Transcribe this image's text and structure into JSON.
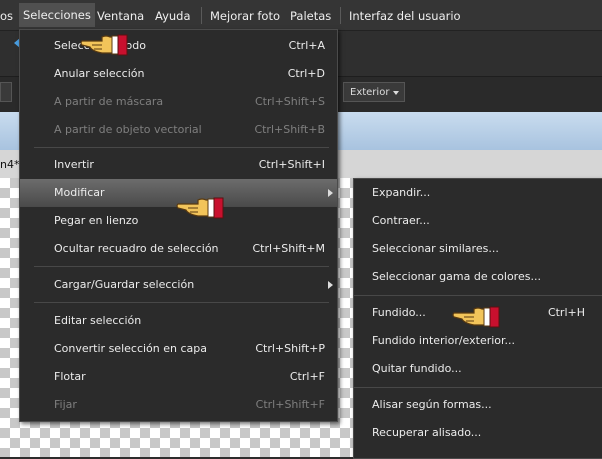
{
  "menubar": {
    "items": [
      "os",
      "Selecciones",
      "Ventana",
      "Ayuda",
      "Mejorar foto",
      "Paletas",
      "Interfaz del usuario"
    ]
  },
  "background": {
    "tab_label": "n4*",
    "dropdown_label": "Exterior"
  },
  "main_menu": [
    {
      "label": "Seleccionar todo",
      "shortcut": "Ctrl+A"
    },
    {
      "label": "Anular selección",
      "shortcut": "Ctrl+D"
    },
    {
      "label": "A partir de máscara",
      "shortcut": "Ctrl+Shift+S"
    },
    {
      "label": "A partir de objeto vectorial",
      "shortcut": "Ctrl+Shift+B"
    },
    {
      "label": "Invertir",
      "shortcut": "Ctrl+Shift+I"
    },
    {
      "label": "Modificar",
      "shortcut": ""
    },
    {
      "label": "Pegar en lienzo",
      "shortcut": ""
    },
    {
      "label": "Ocultar recuadro de selección",
      "shortcut": "Ctrl+Shift+M"
    },
    {
      "label": "Cargar/Guardar selección",
      "shortcut": ""
    },
    {
      "label": "Editar selección",
      "shortcut": ""
    },
    {
      "label": "Convertir selección en capa",
      "shortcut": "Ctrl+Shift+P"
    },
    {
      "label": "Flotar",
      "shortcut": "Ctrl+F"
    },
    {
      "label": "Fijar",
      "shortcut": "Ctrl+Shift+F"
    }
  ],
  "sub_menu": [
    {
      "label": "Expandir...",
      "shortcut": ""
    },
    {
      "label": "Contraer...",
      "shortcut": ""
    },
    {
      "label": "Seleccionar similares...",
      "shortcut": ""
    },
    {
      "label": "Seleccionar gama de colores...",
      "shortcut": ""
    },
    {
      "label": "Fundido...",
      "shortcut": "Ctrl+H"
    },
    {
      "label": "Fundido interior/exterior...",
      "shortcut": ""
    },
    {
      "label": "Quitar fundido...",
      "shortcut": ""
    },
    {
      "label": "Alisar según formas...",
      "shortcut": ""
    },
    {
      "label": "Recuperar alisado...",
      "shortcut": ""
    }
  ],
  "colors": {
    "menu_bg": "#2b2b2b",
    "highlight": "#5a5a5a",
    "disabled_text": "#7f7f7f",
    "hand_cuff": "#c8102e"
  },
  "icons": [
    "pointing-hand-icon",
    "submenu-arrow-icon",
    "dropdown-arrow-icon"
  ]
}
